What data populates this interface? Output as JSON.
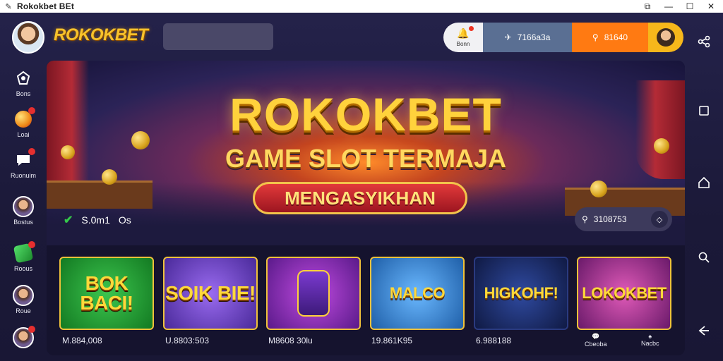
{
  "window": {
    "title": "Rokokbet BEt",
    "controls": [
      "minimize",
      "maximize",
      "close"
    ]
  },
  "header": {
    "brand": "ROKOKBET",
    "notif_label": "Bonn",
    "login_label": "7166a3a",
    "register_label": "81640"
  },
  "sidebar": {
    "items": [
      {
        "label": "Bons",
        "icon": "gamepad-icon"
      },
      {
        "label": "Loai",
        "icon": "lottery-ball-icon"
      },
      {
        "label": "Ruonuim",
        "icon": "chat-icon"
      },
      {
        "label": "Bostus",
        "icon": "avatar"
      },
      {
        "label": "Roous",
        "icon": "gift-icon"
      },
      {
        "label": "Roue",
        "icon": "avatar"
      },
      {
        "label": "",
        "icon": "avatar"
      }
    ]
  },
  "banner": {
    "headline": "ROKOKBET",
    "subline": "GAME SLOT TERMAJA",
    "ribbon": "MENGASYIKHAN",
    "stat_left_a": "S.0m1",
    "stat_left_b": "Os",
    "stat_chip_value": "3108753"
  },
  "games": [
    {
      "title": "BOK BACI!",
      "label": "M.884,008",
      "bg": "#1e8e2c"
    },
    {
      "title": "SOIK BIE!",
      "label": "U.8803:503",
      "bg": "#6b3fb4"
    },
    {
      "title": "",
      "label": "M8608 30lu",
      "bg": "#7b2aa6"
    },
    {
      "title": "MALCO",
      "label": "19.861K95",
      "bg": "#2b7dc2"
    },
    {
      "title": "HIGKOHF!",
      "label": "6.988188",
      "bg": "#1c2c6e"
    },
    {
      "title": "LOKOKBET",
      "label": "",
      "bg": "#a3238a"
    }
  ],
  "bottom_right": {
    "left_label": "Cbeoba",
    "right_label": "Nacbc"
  },
  "right_rail": {
    "icons": [
      "share-icon",
      "square-icon",
      "home-icon",
      "search-icon",
      "back-icon"
    ]
  },
  "colors": {
    "accent_gold": "#f7c22b",
    "login_pill": "#5a6f93",
    "register_pill": "#ff7a12",
    "background": "#1c1a3a"
  }
}
